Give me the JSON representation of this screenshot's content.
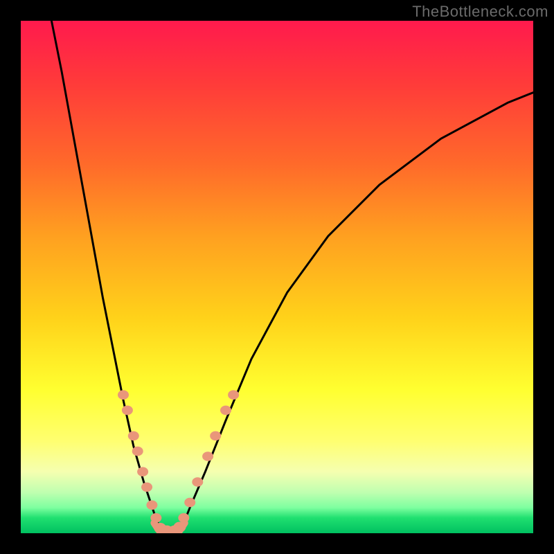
{
  "watermark": "TheBottleneck.com",
  "chart_data": {
    "type": "line",
    "title": "",
    "xlabel": "",
    "ylabel": "",
    "xlim": [
      0,
      100
    ],
    "ylim": [
      0,
      100
    ],
    "axes_visible": false,
    "background_gradient": [
      "#ff1a4d",
      "#ff6a2a",
      "#ffd21a",
      "#ffff70",
      "#7effa0",
      "#00c060"
    ],
    "series": [
      {
        "name": "left-curve",
        "stroke": "#000000",
        "x": [
          6,
          8,
          10,
          12,
          14,
          16,
          18,
          20,
          22,
          24,
          26,
          27.5
        ],
        "y": [
          100,
          90,
          79,
          68,
          57,
          46,
          36,
          26,
          17,
          10,
          4,
          0
        ]
      },
      {
        "name": "right-curve",
        "stroke": "#000000",
        "x": [
          31,
          33,
          36,
          40,
          45,
          52,
          60,
          70,
          82,
          95,
          100
        ],
        "y": [
          0,
          5,
          12,
          22,
          34,
          47,
          58,
          68,
          77,
          84,
          86
        ]
      },
      {
        "name": "valley-floor",
        "stroke": "#e9967a",
        "x": [
          26,
          27,
          28,
          29,
          30,
          31,
          32
        ],
        "y": [
          2,
          0.5,
          0,
          0,
          0,
          0.5,
          2
        ]
      }
    ],
    "marker_groups": [
      {
        "name": "left-branch-markers",
        "color": "#e9967a",
        "r": 8,
        "points": [
          {
            "x": 20.0,
            "y": 27
          },
          {
            "x": 20.8,
            "y": 24
          },
          {
            "x": 22.0,
            "y": 19
          },
          {
            "x": 22.8,
            "y": 16
          },
          {
            "x": 23.8,
            "y": 12
          },
          {
            "x": 24.6,
            "y": 9
          },
          {
            "x": 25.6,
            "y": 5.5
          },
          {
            "x": 26.4,
            "y": 3
          }
        ]
      },
      {
        "name": "right-branch-markers",
        "color": "#e9967a",
        "r": 8,
        "points": [
          {
            "x": 31.8,
            "y": 3
          },
          {
            "x": 33.0,
            "y": 6
          },
          {
            "x": 34.5,
            "y": 10
          },
          {
            "x": 36.5,
            "y": 15
          },
          {
            "x": 38.0,
            "y": 19
          },
          {
            "x": 40.0,
            "y": 24
          },
          {
            "x": 41.5,
            "y": 27
          }
        ]
      },
      {
        "name": "valley-bottom-markers",
        "color": "#e9967a",
        "r": 9,
        "points": [
          {
            "x": 27.2,
            "y": 1.0
          },
          {
            "x": 28.5,
            "y": 0.5
          },
          {
            "x": 30.0,
            "y": 0.5
          },
          {
            "x": 31.0,
            "y": 1.2
          }
        ]
      }
    ]
  }
}
